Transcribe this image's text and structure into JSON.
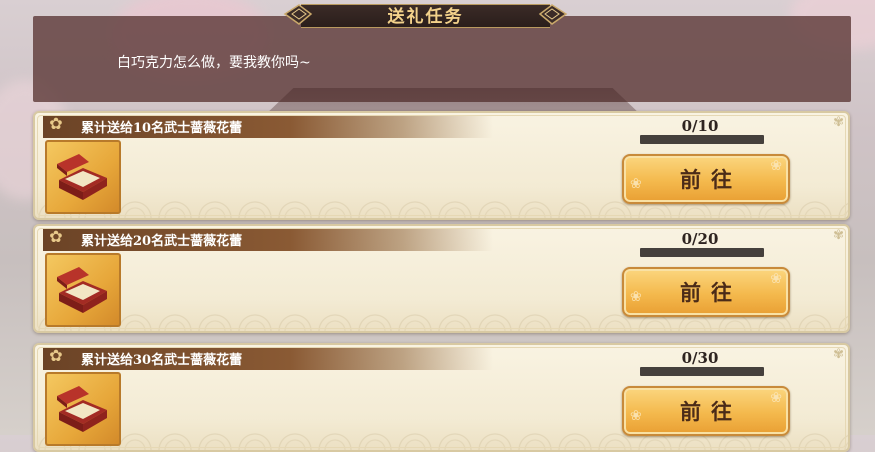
{
  "header": {
    "title": "送礼任务"
  },
  "dialog": {
    "text": "白巧克力怎么做，要我教你吗~"
  },
  "tasks": [
    {
      "title": "累计送给10名武士蔷薇花蕾",
      "progress": "0/10",
      "progress_value": 0,
      "button_label": "前往",
      "icon": "gift-box-icon"
    },
    {
      "title": "累计送给20名武士蔷薇花蕾",
      "progress": "0/20",
      "progress_value": 0,
      "button_label": "前往",
      "icon": "gift-box-icon"
    },
    {
      "title": "累计送给30名武士蔷薇花蕾",
      "progress": "0/30",
      "progress_value": 0,
      "button_label": "前往",
      "icon": "gift-box-icon"
    }
  ],
  "colors": {
    "accent": "#f4b94d",
    "ribbon": "#6b4326",
    "dialog_bg": "#5f3c3a",
    "title_text": "#f3d28b"
  }
}
